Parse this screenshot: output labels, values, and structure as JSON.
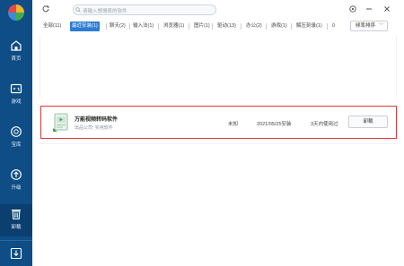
{
  "search": {
    "placeholder": "请输入想搜索的软件"
  },
  "sidebar": {
    "items": [
      {
        "label": "首页",
        "icon": "home-icon"
      },
      {
        "label": "游戏",
        "icon": "gamepad-icon"
      },
      {
        "label": "宝库",
        "icon": "treasure-icon"
      },
      {
        "label": "升级",
        "icon": "upgrade-icon"
      },
      {
        "label": "卸载",
        "icon": "trash-icon"
      }
    ],
    "bottom_icon": "download-icon"
  },
  "tabs": [
    {
      "label": "全部(11)"
    },
    {
      "label": "最近安装(1)"
    },
    {
      "label": "聊天(2)"
    },
    {
      "label": "输入法(1)"
    },
    {
      "label": "浏览器(1)"
    },
    {
      "label": "图片(1)"
    },
    {
      "label": "驱动(13)"
    },
    {
      "label": "办公(2)"
    },
    {
      "label": "游戏(1)"
    },
    {
      "label": "解压刻录(1)"
    },
    {
      "label": "0"
    }
  ],
  "sort": {
    "label": "频率排序",
    "chevron": "﹀"
  },
  "app": {
    "name": "万能视频转码软件",
    "meta": "出品公司: 实用软件",
    "size": "未知",
    "date": "2021/05/25安装",
    "usage": "3天内使用过",
    "action": "卸载"
  },
  "colors": {
    "sidebar": "#0e4d86",
    "accent": "#2d7cd6",
    "highlight": "#e0383c"
  }
}
